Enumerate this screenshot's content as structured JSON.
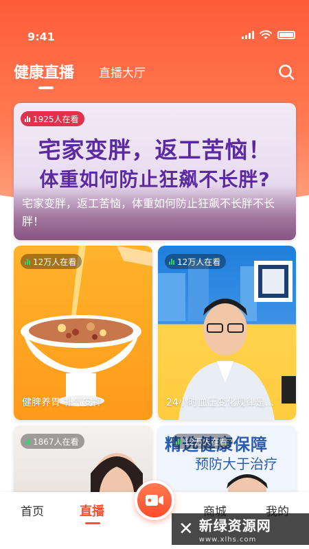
{
  "status_bar": {
    "time": "9:41"
  },
  "header": {
    "tab_active": "健康直播",
    "tab_inactive": "直播大厅"
  },
  "featured": {
    "viewers": "1925人在看",
    "headline_line1": "宅家变胖，返工苦恼！",
    "headline_line2": "体重如何防止狂飙不长胖?",
    "caption": "宅家变胖，返工苦恼，体重如何防止狂飙不长胖不长胖！"
  },
  "cards": [
    {
      "viewers": "12万人在看",
      "title": "健脾养胃 补气安神"
    },
    {
      "viewers": "12万人在看",
      "title": "24小时血压变化规律是..."
    },
    {
      "viewers": "1867人在看",
      "title": ""
    },
    {
      "viewers": "12万人在看",
      "promo_line1": "精选健康保障",
      "promo_line2": "预防大于治疗"
    }
  ],
  "bottom_nav": {
    "home": "首页",
    "live": "直播",
    "mall": "商城",
    "mine": "我的"
  },
  "watermark": {
    "main": "新绿资源网",
    "sub": "www.xlhs.com"
  },
  "colors": {
    "accent": "#ff4d2d",
    "header_gradient_top": "#ff5c3a",
    "headline_purple": "#5b2aa0"
  },
  "icons": {
    "search": "search-icon",
    "record": "video-camera-icon",
    "viewers": "bar-chart-icon"
  }
}
